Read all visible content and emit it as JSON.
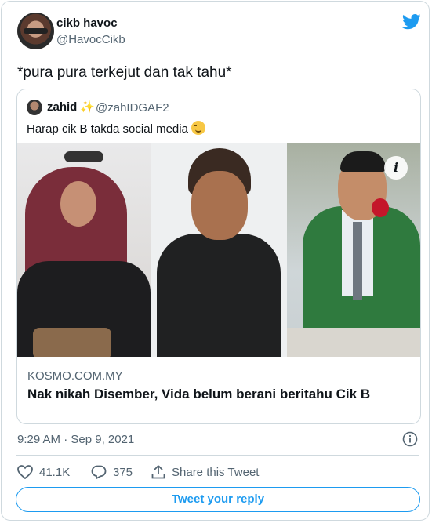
{
  "author": {
    "display_name": "cikb havoc",
    "handle": "@HavocCikb"
  },
  "tweet": {
    "text": "*pura pura terkejut dan tak tahu*"
  },
  "quoted": {
    "display_name": "zahid",
    "handle": "@zahIDGAF2",
    "text": "Harap cik B takda social media",
    "link": {
      "source": "KOSMO.COM.MY",
      "headline": "Nak nikah Disember, Vida belum berani beritahu Cik B"
    }
  },
  "meta": {
    "timestamp": "9:29 AM · Sep 9, 2021"
  },
  "actions": {
    "likes": "41.1K",
    "replies": "375",
    "share_label": "Share this Tweet"
  },
  "reply_button_label": "Tweet your reply",
  "colors": {
    "accent": "#1d9bf0",
    "muted": "#536471",
    "border": "#cfd9de"
  },
  "icons": [
    "twitter-bird-icon",
    "info-icon",
    "heart-icon",
    "reply-icon",
    "share-icon"
  ]
}
